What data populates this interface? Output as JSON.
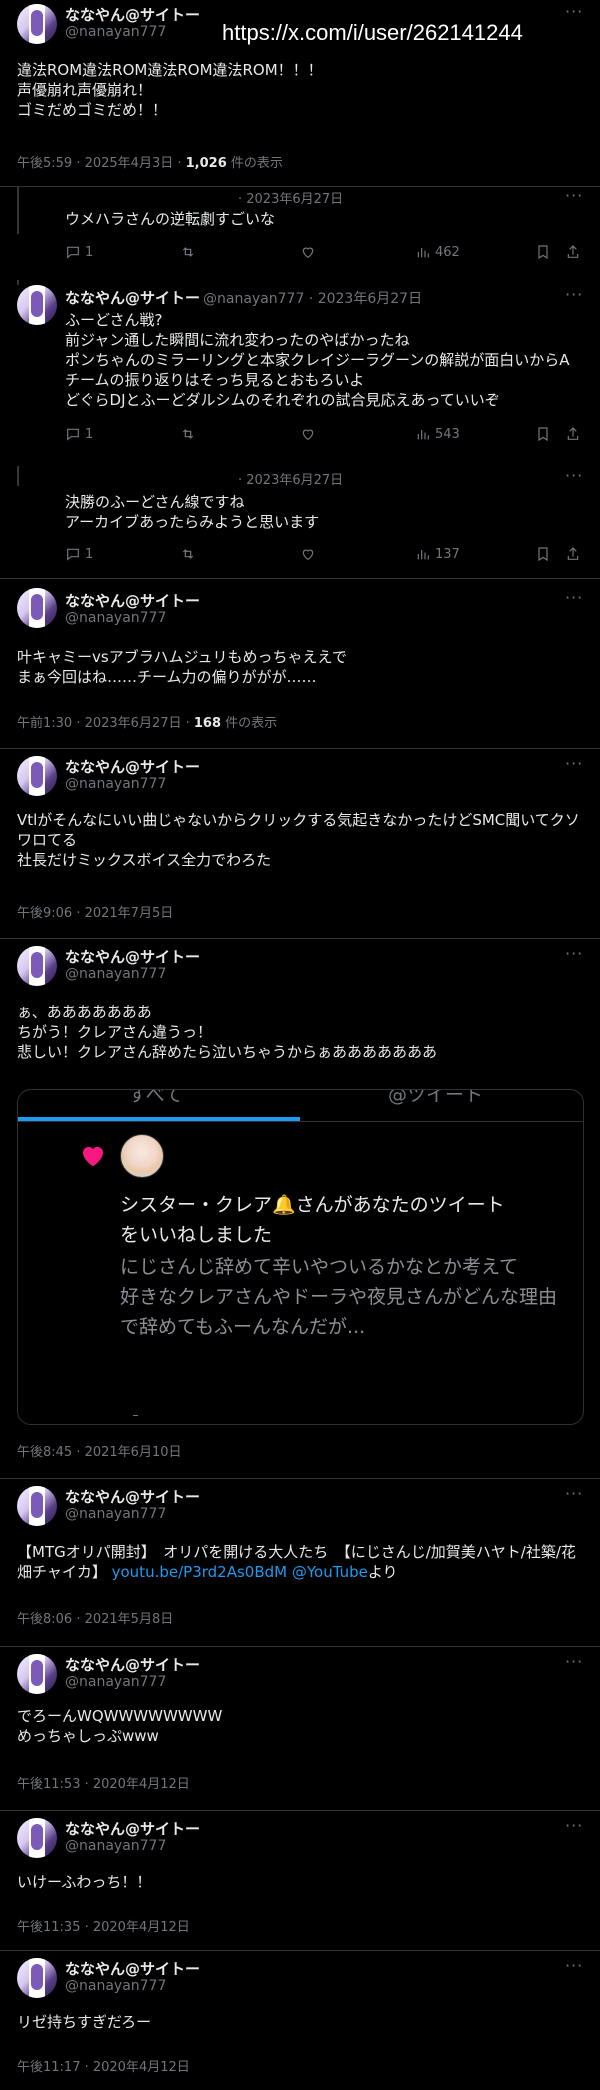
{
  "overlay_url": "https://x.com/i/user/262141244",
  "user": {
    "name": "ななやん@サイトー",
    "handle": "@nanayan777"
  },
  "more_icon": "more-horizontal-icon",
  "tweet1": {
    "text": "違法ROM違法ROM違法ROM違法ROM！！！\n声優崩れ声優崩れ！\nゴミだめゴミだめ！！",
    "time": "午後5:59 · 2025年4月3日 · ",
    "views": "1,026",
    "views_suffix": " 件の表示"
  },
  "reply1": {
    "date": "· 2023年6月27日",
    "text": "ウメハラさんの逆転劇すごいな",
    "replies": "1",
    "retweets": "",
    "likes": "",
    "views": "462"
  },
  "reply2": {
    "handle_date": "@nanayan777 · 2023年6月27日",
    "text": "ふーどさん戦?\n前ジャン通した瞬間に流れ変わったのやばかったね\nポンちゃんのミラーリングと本家クレイジーラグーンの解説が面白いからA\nチームの振り返りはそっち見るとおもろいよ\nどぐらDJとふーどダルシムのそれぞれの試合見応えあっていいぞ",
    "replies": "1",
    "retweets": "",
    "likes": "",
    "views": "543"
  },
  "reply3": {
    "date": "· 2023年6月27日",
    "text": "決勝のふーどさん線ですね\nアーカイブあったらみようと思います",
    "replies": "1",
    "retweets": "",
    "likes": "",
    "views": "137"
  },
  "tweet2": {
    "text": "叶キャミーvsアブラハムジュリもめっちゃええで\nまぁ今回はね……チーム力の偏りががが……",
    "time": "午前1:30 · 2023年6月27日 · ",
    "views": "168",
    "views_suffix": " 件の表示"
  },
  "tweet3": {
    "text": "Vtlがそんなにいい曲じゃないからクリックする気起きなかったけどSMC聞いてクソワロてる\n社長だけミックスボイス全力でわろた",
    "time": "午後9:06 · 2021年7月5日"
  },
  "tweet4": {
    "text": "ぁ、あああああああ\nちがう！クレアさん違うっ！\n悲しい！クレアさん辞めたら泣いちゃうからぁあああああああ",
    "time": "午後8:45 · 2021年6月10日",
    "embed": {
      "tab1": "すべて",
      "tab2": "@ツイート",
      "title": "シスター・クレア🔔さんがあなたのツイート\nをいいねしました",
      "body": "にじさんじ辞めて辛いやついるかなとか考えて\n好きなクレアさんやドーラや夜見さんがどんな理由で辞めてもふーんなんだが..."
    }
  },
  "tweet5": {
    "text_before": "【MTGオリパ開封】　オリパを開ける大人たち　【にじさんじ/加賀美ハヤト/社築/花畑チャイカ】 ",
    "link1": "youtu.be/P3rd2As0BdM",
    "link2": "@YouTube",
    "text_after": "より",
    "time": "午後8:06 · 2021年5月8日"
  },
  "tweet6": {
    "text": "でろーんWQWWWWWWWW\nめっちゃしっぷwww",
    "time": "午後11:53 · 2020年4月12日"
  },
  "tweet7": {
    "text": "いけーふわっち！！",
    "time": "午後11:35 · 2020年4月12日"
  },
  "tweet8": {
    "text": "リゼ持ちすぎだろー",
    "time": "午後11:17 · 2020年4月12日"
  },
  "colors": {
    "background": "#000000",
    "text": "#e7e9ea",
    "muted": "#71767b",
    "link": "#1d9bf0",
    "like": "#f91880"
  }
}
